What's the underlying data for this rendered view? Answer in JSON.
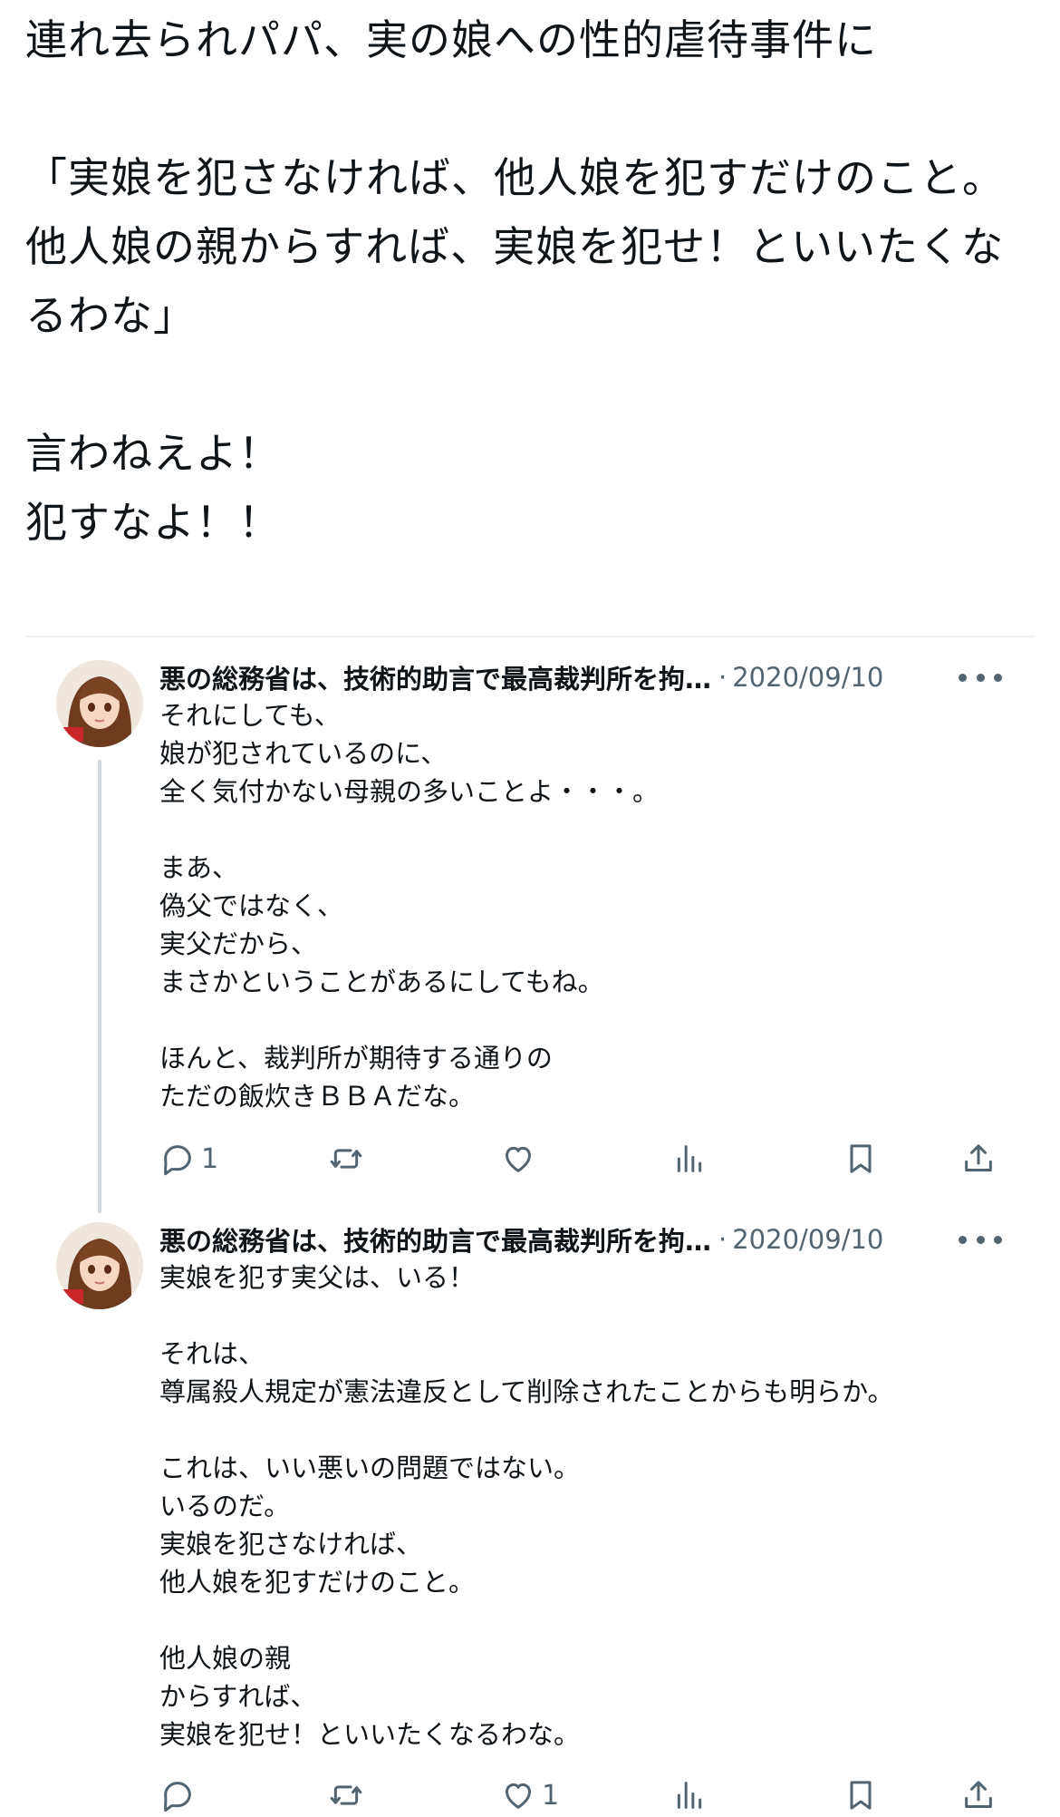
{
  "intro": {
    "lines": [
      "連れ去られパパ、実の娘への性的虐待事件に",
      "",
      "「実娘を犯さなければ、他人娘を犯すだけのこと。",
      "他人娘の親からすれば、実娘を犯せ！といいたくな",
      "るわな」",
      "",
      "言わねえよ！",
      "犯すなよ！！"
    ]
  },
  "tweets": [
    {
      "author": "悪の総務省は、技術的助言で最高裁判所を拘…",
      "separator": "·",
      "date": "2020/09/10",
      "lines": [
        "それにしても、",
        "娘が犯されているのに、",
        "全く気付かない母親の多いことよ・・・。",
        "",
        "まあ、",
        "偽父ではなく、",
        "実父だから、",
        "まさかということがあるにしてもね。",
        "",
        "ほんと、裁判所が期待する通りの",
        "ただの飯炊きＢＢＡだな。"
      ],
      "reply_count": "1",
      "like_count": ""
    },
    {
      "author": "悪の総務省は、技術的助言で最高裁判所を拘…",
      "separator": "·",
      "date": "2020/09/10",
      "lines": [
        "実娘を犯す実父は、いる！",
        "",
        "それは、",
        "尊属殺人規定が憲法違反として削除されたことからも明らか。",
        "",
        "これは、いい悪いの問題ではない。",
        "いるのだ。",
        "実娘を犯さなければ、",
        "他人娘を犯すだけのこと。",
        "",
        "他人娘の親",
        "からすれば、",
        "実娘を犯せ！といいたくなるわな。"
      ],
      "reply_count": "",
      "like_count": "1"
    }
  ],
  "icons": {
    "reply": "reply-icon",
    "retweet": "retweet-icon",
    "like": "like-icon",
    "views": "views-icon",
    "bookmark": "bookmark-icon",
    "share": "share-icon",
    "more": "more-icon"
  },
  "colors": {
    "text": "#0f1419",
    "secondary": "#536471",
    "thread_line": "#cfd9de",
    "divider": "#eff3f4"
  }
}
